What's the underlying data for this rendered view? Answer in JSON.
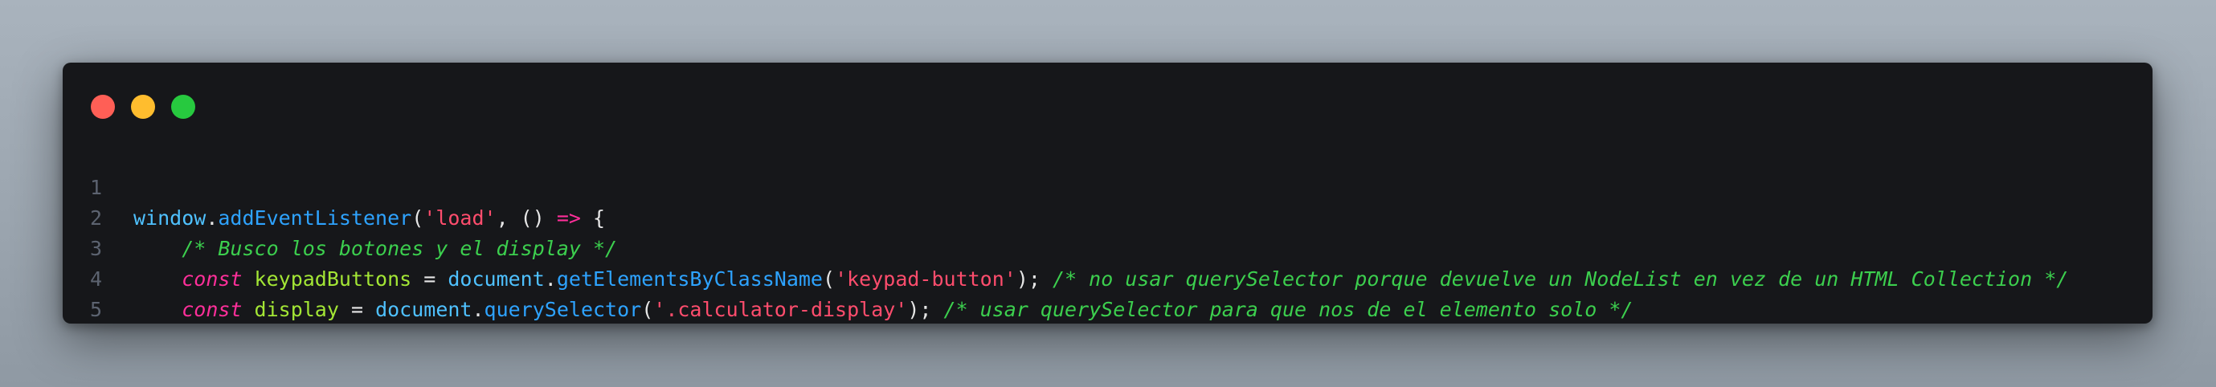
{
  "window": {
    "traffic_lights": [
      {
        "name": "close",
        "color": "#ff5f56"
      },
      {
        "name": "minimize",
        "color": "#ffbd2e"
      },
      {
        "name": "maximize",
        "color": "#27c93f"
      }
    ]
  },
  "code": {
    "language": "javascript",
    "lines": [
      {
        "number": "1",
        "tokens": {
          "t1": "window",
          "t2": ".",
          "t3": "addEventListener",
          "t4": "(",
          "t5": "'load'",
          "t6": ", () ",
          "t7": "=>",
          "t8": " {"
        }
      },
      {
        "number": "2",
        "tokens": {
          "t1": "    ",
          "t2": "/* Busco los botones y el display */"
        }
      },
      {
        "number": "3",
        "tokens": {
          "t1": "    ",
          "t2": "const",
          "t3": " ",
          "t4": "keypadButtons",
          "t5": " = ",
          "t6": "document",
          "t7": ".",
          "t8": "getElementsByClassName",
          "t9": "(",
          "t10": "'keypad-button'",
          "t11": "); ",
          "t12": "/* no usar querySelector porque devuelve un NodeList en vez de un HTML Collection */"
        }
      },
      {
        "number": "4",
        "tokens": {
          "t1": "    ",
          "t2": "const",
          "t3": " ",
          "t4": "display",
          "t5": " = ",
          "t6": "document",
          "t7": ".",
          "t8": "querySelector",
          "t9": "(",
          "t10": "'.calculator-display'",
          "t11": "); ",
          "t12": "/* usar querySelector para que nos de el elemento solo */"
        }
      },
      {
        "number": "5",
        "tokens": {}
      }
    ]
  },
  "colors": {
    "window_bg": "#16171a",
    "line_number": "#5c6370",
    "keyword": "#ff2f9a",
    "string": "#ff4d6d",
    "function": "#2ea3ff",
    "object": "#4fc1ff",
    "variable": "#a3e635",
    "comment": "#3ccf4e",
    "plain": "#e6e6e6"
  }
}
